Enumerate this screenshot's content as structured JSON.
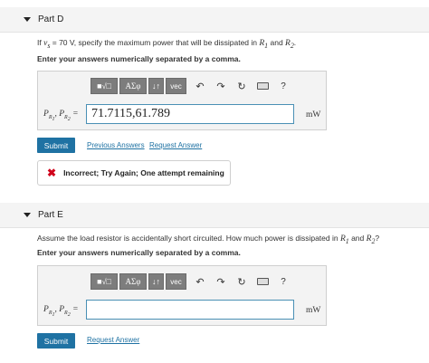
{
  "part_d": {
    "title": "Part D",
    "prompt_pre": "If ",
    "prompt_var": "vs",
    "prompt_eq": " = 70 V",
    "prompt_post": ", specify the maximum power that will be dissipated in ",
    "r1": "R1",
    "and": " and ",
    "r2": "R2",
    "end": ".",
    "instruction": "Enter your answers numerically separated by a comma.",
    "label": "PR1, PR2 =",
    "value": "71.7115,61.789",
    "unit": "mW",
    "submit": "Submit",
    "link_previous": "Previous Answers",
    "link_request": "Request Answer",
    "feedback": "Incorrect; Try Again; One attempt remaining"
  },
  "part_e": {
    "title": "Part E",
    "prompt": "Assume the load resistor is accidentally short circuited. How much power is dissipated in ",
    "r1": "R1",
    "and": " and ",
    "r2": "R2",
    "end": "?",
    "instruction": "Enter your answers numerically separated by a comma.",
    "label": "PR1, PR2 =",
    "value": "",
    "unit": "mW",
    "submit": "Submit",
    "link_request": "Request Answer"
  },
  "toolbar": {
    "templates": "■√□",
    "greek": "ΑΣφ",
    "arrows": "↓↑",
    "vec": "vec",
    "undo": "↶",
    "redo": "↷",
    "reset": "↻",
    "help": "?"
  },
  "icons": [
    "caret-down-icon",
    "undo-icon",
    "redo-icon",
    "reset-icon",
    "keyboard-icon",
    "help-icon",
    "x-icon"
  ],
  "colors": {
    "accent": "#1f72a3",
    "error": "#d0021b",
    "input_border": "#4a90b5"
  }
}
